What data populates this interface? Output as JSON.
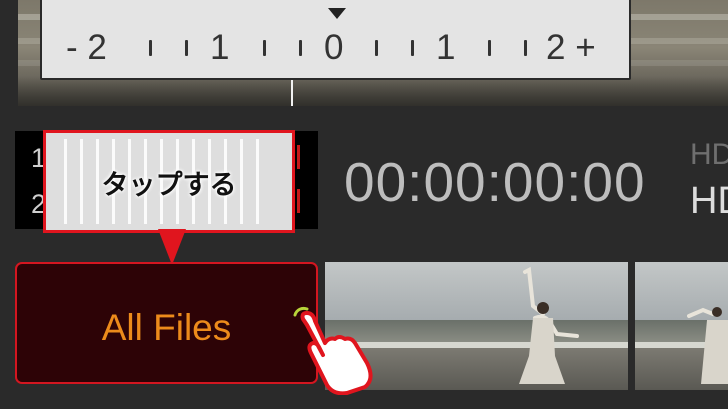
{
  "exposure_scale": {
    "labels": [
      "- 2",
      "1",
      "0",
      "1",
      "2 +"
    ]
  },
  "audio_meter": {
    "channels": [
      "1",
      "2"
    ]
  },
  "tooltip": {
    "text": "タップする"
  },
  "timecode": "00:00:00:00",
  "format": {
    "line1": "HD",
    "line2": "HD"
  },
  "all_files_button": {
    "label": "All Files"
  },
  "colors": {
    "accent_red": "#e0151e",
    "button_text": "#ec8b1b",
    "button_bg": "#2d0306"
  }
}
